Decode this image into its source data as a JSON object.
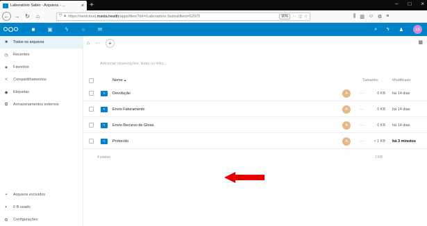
{
  "browser": {
    "tab_title": "Laboratório Sabin - Arquivos - ...",
    "url_prefix": "https://nextcloud.",
    "url_domain": "maida.health",
    "url_suffix": "/apps/files/?dir=/Laboratório Sabin&fileid=52975",
    "zoom": "90%"
  },
  "header": {
    "avatar_initials": "LS"
  },
  "sidebar": {
    "items": [
      {
        "label": "Todos os arquivos",
        "icon": "folder-icon"
      },
      {
        "label": "Recentes",
        "icon": "clock-icon"
      },
      {
        "label": "Favoritos",
        "icon": "star-icon"
      },
      {
        "label": "Compartilhamentos",
        "icon": "share-icon"
      },
      {
        "label": "Etiquetas",
        "icon": "tag-icon"
      },
      {
        "label": "Armazenamentos externos",
        "icon": "external-icon"
      }
    ],
    "bottom": [
      {
        "label": "Arquivos excluídos",
        "icon": "trash-icon"
      },
      {
        "label": "0 B usado",
        "icon": "pie-icon"
      },
      {
        "label": "Configurações",
        "icon": "gear-icon"
      }
    ]
  },
  "main": {
    "comment_placeholder": "Adicionar observações, listas ou links...",
    "columns": {
      "name": "Nome",
      "size": "Tamanho",
      "modified": "Modificado"
    },
    "files": [
      {
        "name": "Devolução",
        "size": "0 KB",
        "modified": "há 14 dias",
        "avatar": "A"
      },
      {
        "name": "Envio Faturamento",
        "size": "0 KB",
        "modified": "há 14 dias",
        "avatar": "A"
      },
      {
        "name": "Envio Recurso de Glosa",
        "size": "0 KB",
        "modified": "há 14 dias",
        "avatar": "A"
      },
      {
        "name": "Protocolo",
        "size": "< 1 KB",
        "modified": "há 3 minutos",
        "avatar": "A"
      }
    ],
    "summary_count": "4 pastas",
    "summary_size": "1 KB"
  }
}
